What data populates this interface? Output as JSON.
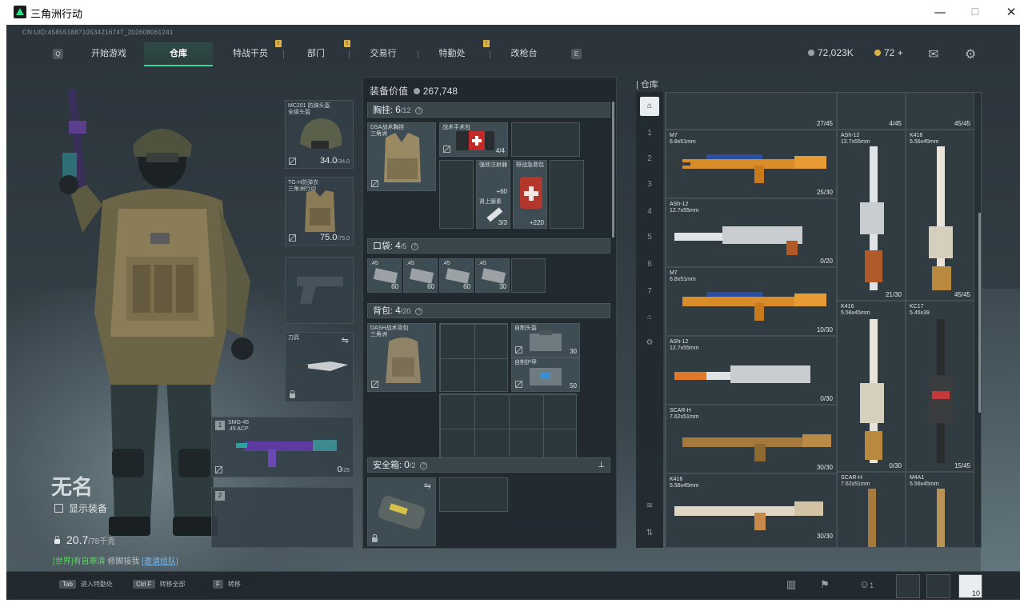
{
  "window": {
    "title": "三角洲行动",
    "min": "—",
    "max": "☐",
    "close": "✕"
  },
  "uid": "CN:UID:4585518871053421674​7_202608061241",
  "nav": {
    "left_key": "Q",
    "right_key": "E",
    "items": [
      "开始游戏",
      "仓库",
      "特战干员",
      "部门",
      "交易行",
      "特勤处",
      "改枪台"
    ],
    "active": "仓库",
    "badges": [
      "!",
      "!",
      "!"
    ]
  },
  "currency": {
    "silver": "72,023K",
    "gold": "72",
    "gold_plus": "+"
  },
  "top_icons": [
    "mail-icon",
    "settings-icon"
  ],
  "operator": {
    "name": "无名",
    "show_equipment": "显示装备",
    "weight": "20.7",
    "weight_max": "/78千克"
  },
  "chat": {
    "channel": "[世界]",
    "user": "有自寒清",
    "text": "修脚接我",
    "link": "[邀请组队]"
  },
  "gear": {
    "helmet": {
      "label": "MC201 防弹头盔",
      "sub": "全级头盔",
      "durability": "34.0",
      "max": "/34.0"
    },
    "armor": {
      "label": "TG-H防弹衣",
      "sub": "三角洲行动",
      "durability": "75.0",
      "max": "/75.0"
    },
    "melee_label": "刀具",
    "weapon1": {
      "slot": "1",
      "name": "SMG-45",
      "ammo_type": ".45 ACP",
      "ammo": "0",
      "ammo_max": "/25"
    },
    "weapon2": {
      "slot": "2"
    }
  },
  "equipment": {
    "value_label": "装备价值",
    "value": "267,748",
    "chest_title": "胸挂:",
    "chest_used": "6",
    "chest_cap": "/12",
    "chest_rig": {
      "label": "DSA战术胸挂",
      "sub": "三角洲"
    },
    "medkit": {
      "label": "战术手术包",
      "count": "4/4"
    },
    "injector": {
      "label": "强效注射器",
      "count": "+60",
      "sub": "肾上腺素",
      "count2": "3/3"
    },
    "firstaid": {
      "label": "野战急救包",
      "count": "+220"
    },
    "pocket_title": "口袋:",
    "pocket_used": "4",
    "pocket_cap": "/5",
    "pocket_items": [
      {
        "label": ".45",
        "count": "60"
      },
      {
        "label": ".45",
        "count": "60"
      },
      {
        "label": ".45",
        "count": "60"
      },
      {
        "label": ".45",
        "count": "30"
      }
    ],
    "backpack_title": "背包:",
    "backpack_used": "4",
    "backpack_cap": "/20",
    "backpack": {
      "label": "DASH战术背包",
      "sub": "三角洲"
    },
    "armor_plate1": {
      "label": "自制头盔",
      "count": "30"
    },
    "armor_plate2": {
      "label": "自制护甲",
      "count": "50"
    },
    "safe_title": "安全箱:",
    "safe_used": "0",
    "safe_cap": "/2"
  },
  "stash": {
    "title": "仓库",
    "top_counts": [
      "27/45",
      "4/45",
      "45/45"
    ],
    "items": [
      {
        "name": "M7",
        "ammo": "6.8x51mm",
        "count": "25/30"
      },
      {
        "name": "ASh-12",
        "ammo": "12.7x55mm",
        "count": "21/30"
      },
      {
        "name": "K416",
        "ammo": "5.56x45mm",
        "count": "45/45"
      },
      {
        "name": "ASh-12",
        "ammo": "12.7x55mm",
        "count": "0/20"
      },
      {
        "name": "M7",
        "ammo": "6.8x51mm",
        "count": "10/30"
      },
      {
        "name": "K416",
        "ammo": "5.56x45mm",
        "count": "0/30"
      },
      {
        "name": "KC17",
        "ammo": "5.45x39",
        "count": "15/45"
      },
      {
        "name": "ASh-12",
        "ammo": "12.7x55mm",
        "count": "0/30"
      },
      {
        "name": "SCAR-H",
        "ammo": "7.62x51mm",
        "count": "30/30"
      },
      {
        "name": "K416",
        "ammo": "5.56x45mm",
        "count": "30/30"
      },
      {
        "name": "SCAR-H",
        "ammo": "7.62x51mm",
        "count": ""
      },
      {
        "name": "M4A1",
        "ammo": "5.56x45mm",
        "count": ""
      }
    ],
    "tab_labels": [
      "1",
      "2",
      "3",
      "4",
      "5",
      "6",
      "7"
    ]
  },
  "hotkeys": [
    {
      "key": "Tab",
      "label": "进入特勤处"
    },
    {
      "key": "Ctrl F",
      "label": "转移全部"
    },
    {
      "key": "F",
      "label": "转移"
    }
  ],
  "party_count": "1",
  "avatar_level": "10"
}
